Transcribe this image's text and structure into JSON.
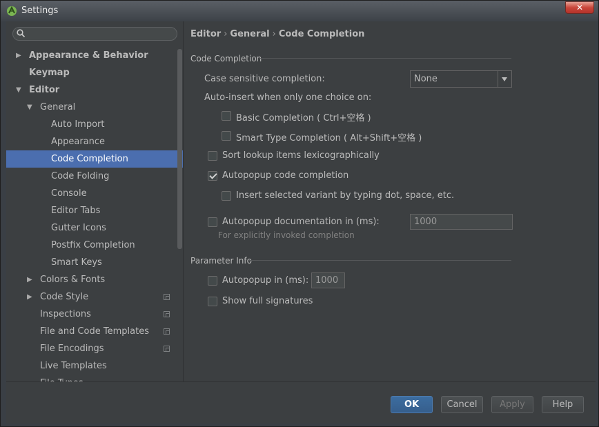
{
  "window": {
    "title": "Settings",
    "close_label": "✕"
  },
  "search": {
    "value": "",
    "placeholder": ""
  },
  "tree": [
    {
      "label": "Appearance & Behavior",
      "level": 0,
      "arrow": "▶",
      "bold": true
    },
    {
      "label": "Keymap",
      "level": 0,
      "arrow": "",
      "bold": true
    },
    {
      "label": "Editor",
      "level": 0,
      "arrow": "▼",
      "bold": true
    },
    {
      "label": "General",
      "level": 1,
      "arrow": "▼"
    },
    {
      "label": "Auto Import",
      "level": 2
    },
    {
      "label": "Appearance",
      "level": 2
    },
    {
      "label": "Code Completion",
      "level": 2,
      "selected": true
    },
    {
      "label": "Code Folding",
      "level": 2
    },
    {
      "label": "Console",
      "level": 2
    },
    {
      "label": "Editor Tabs",
      "level": 2
    },
    {
      "label": "Gutter Icons",
      "level": 2
    },
    {
      "label": "Postfix Completion",
      "level": 2
    },
    {
      "label": "Smart Keys",
      "level": 2
    },
    {
      "label": "Colors & Fonts",
      "level": 1,
      "arrow": "▶"
    },
    {
      "label": "Code Style",
      "level": 1,
      "arrow": "▶",
      "project": true
    },
    {
      "label": "Inspections",
      "level": 1,
      "project": true
    },
    {
      "label": "File and Code Templates",
      "level": 1,
      "project": true
    },
    {
      "label": "File Encodings",
      "level": 1,
      "project": true
    },
    {
      "label": "Live Templates",
      "level": 1
    },
    {
      "label": "File Types",
      "level": 1
    }
  ],
  "breadcrumb": {
    "part1": "Editor",
    "part2": "General",
    "part3": "Code Completion",
    "sep": "›"
  },
  "code_completion": {
    "section_title": "Code Completion",
    "case_sensitive_label": "Case sensitive completion:",
    "case_sensitive_value": "None",
    "auto_insert_label": "Auto-insert when only one choice on:",
    "basic_completion": {
      "label": "Basic Completion ( Ctrl+空格 )",
      "checked": false
    },
    "smart_type_completion": {
      "label": "Smart Type Completion ( Alt+Shift+空格 )",
      "checked": false
    },
    "sort_lexicographically": {
      "label": "Sort lookup items lexicographically",
      "checked": false
    },
    "autopopup_completion": {
      "label": "Autopopup code completion",
      "checked": true
    },
    "insert_by_typing": {
      "label": "Insert selected variant by typing dot, space, etc.",
      "checked": false
    },
    "autopopup_documentation": {
      "label": "Autopopup documentation in (ms):",
      "checked": false,
      "value": "1000"
    },
    "documentation_hint": "For explicitly invoked completion"
  },
  "parameter_info": {
    "section_title": "Parameter Info",
    "autopopup": {
      "label": "Autopopup in (ms):",
      "checked": false,
      "value": "1000"
    },
    "show_full_signatures": {
      "label": "Show full signatures",
      "checked": false
    }
  },
  "footer": {
    "ok": "OK",
    "cancel": "Cancel",
    "apply": "Apply",
    "help": "Help"
  },
  "colors": {
    "selection": "#4b6eaf",
    "background": "#3c3f41",
    "text": "#bbbbbb",
    "accent_button": "#365e8c"
  }
}
